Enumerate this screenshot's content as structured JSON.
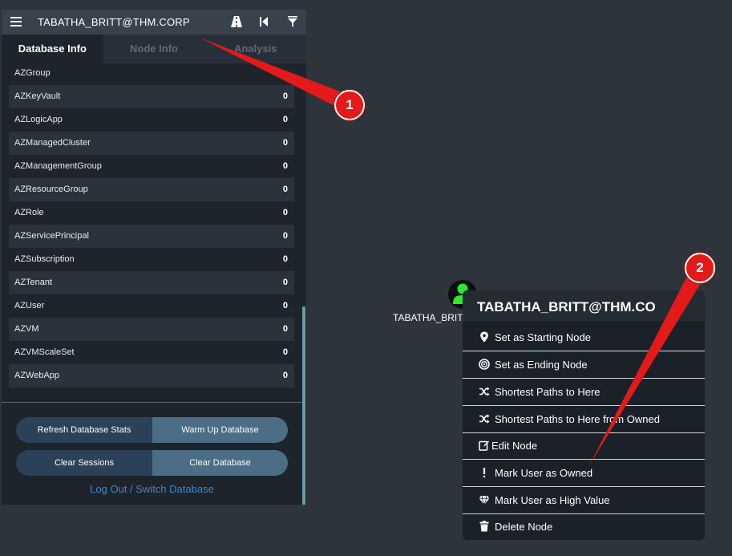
{
  "topbar": {
    "search_text": "TABATHA_BRITT@THM.CORP",
    "icons": [
      "menu-icon",
      "road-icon",
      "back-icon",
      "filter-icon"
    ]
  },
  "tabs": [
    {
      "label": "Database Info",
      "active": true
    },
    {
      "label": "Node Info",
      "active": false
    },
    {
      "label": "Analysis",
      "active": false
    }
  ],
  "node_types": [
    {
      "name": "AZGroup",
      "count": ""
    },
    {
      "name": "AZKeyVault",
      "count": "0"
    },
    {
      "name": "AZLogicApp",
      "count": "0"
    },
    {
      "name": "AZManagedCluster",
      "count": "0"
    },
    {
      "name": "AZManagementGroup",
      "count": "0"
    },
    {
      "name": "AZResourceGroup",
      "count": "0"
    },
    {
      "name": "AZRole",
      "count": "0"
    },
    {
      "name": "AZServicePrincipal",
      "count": "0"
    },
    {
      "name": "AZSubscription",
      "count": "0"
    },
    {
      "name": "AZTenant",
      "count": "0"
    },
    {
      "name": "AZUser",
      "count": "0"
    },
    {
      "name": "AZVM",
      "count": "0"
    },
    {
      "name": "AZVMScaleSet",
      "count": "0"
    },
    {
      "name": "AZWebApp",
      "count": "0"
    }
  ],
  "buttons": {
    "refresh_stats": "Refresh Database Stats",
    "warm_up": "Warm Up Database",
    "clear_sessions": "Clear Sessions",
    "clear_database": "Clear Database",
    "logout": "Log Out / Switch Database"
  },
  "graph_node": {
    "label": "TABATHA_BRIT",
    "icon": "user-icon",
    "color": "#2ee82e"
  },
  "context_menu": {
    "title": "TABATHA_BRITT@THM.CO",
    "items": [
      {
        "label": "Set as Starting Node",
        "icon": "map-marker-icon"
      },
      {
        "label": "Set as Ending Node",
        "icon": "bullseye-icon"
      },
      {
        "label": "Shortest Paths to Here",
        "icon": "shuffle-icon"
      },
      {
        "label": "Shortest Paths to Here from Owned",
        "icon": "shuffle-icon"
      },
      {
        "label": "Edit Node",
        "icon": "edit-icon"
      },
      {
        "label": "Mark User as Owned",
        "icon": "exclamation-icon"
      },
      {
        "label": "Mark User as High Value",
        "icon": "gem-icon"
      },
      {
        "label": "Delete Node",
        "icon": "trash-icon"
      }
    ]
  },
  "annotations": [
    {
      "number": "1"
    },
    {
      "number": "2"
    }
  ],
  "colors": {
    "annotation_red": "#e41919",
    "link_blue": "#3f88c5",
    "owned_green": "#2ee82e"
  }
}
